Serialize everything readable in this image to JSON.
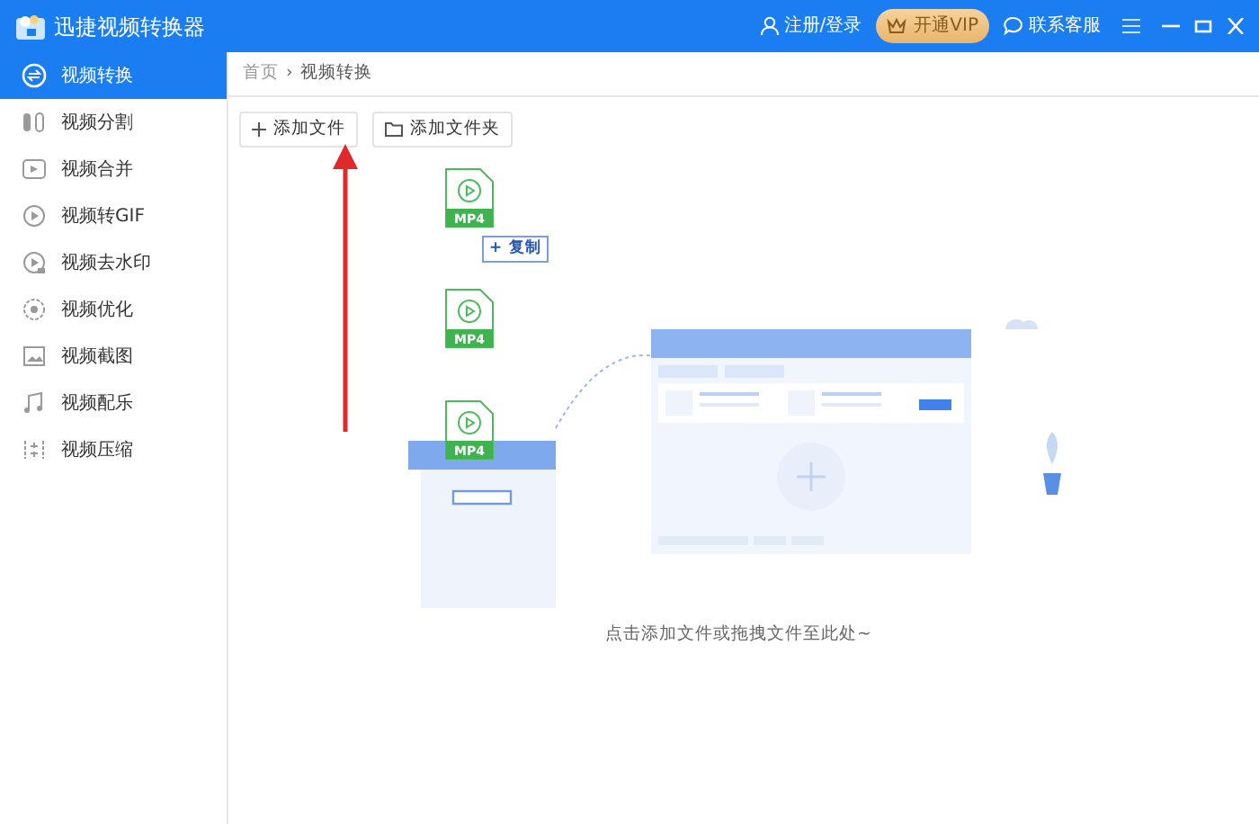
{
  "app": {
    "title": "迅捷视频转换器"
  },
  "header": {
    "login": "注册/登录",
    "vip": "开通VIP",
    "support": "联系客服"
  },
  "sidebar": {
    "items": [
      {
        "label": "视频转换",
        "selected": true,
        "kind": "convert"
      },
      {
        "label": "视频分割",
        "selected": false,
        "kind": "split"
      },
      {
        "label": "视频合并",
        "selected": false,
        "kind": "merge"
      },
      {
        "label": "视频转GIF",
        "selected": false,
        "kind": "gif"
      },
      {
        "label": "视频去水印",
        "selected": false,
        "kind": "watermark"
      },
      {
        "label": "视频优化",
        "selected": false,
        "kind": "optimize"
      },
      {
        "label": "视频截图",
        "selected": false,
        "kind": "screenshot"
      },
      {
        "label": "视频配乐",
        "selected": false,
        "kind": "music"
      },
      {
        "label": "视频压缩",
        "selected": false,
        "kind": "compress"
      }
    ]
  },
  "breadcrumb": {
    "items": [
      "首页",
      "视频转换"
    ],
    "separator": "›"
  },
  "toolbar": {
    "buttons": [
      {
        "label": "添加文件",
        "kind": "plus"
      },
      {
        "label": "添加文件夹",
        "kind": "folder"
      }
    ]
  },
  "dragged_files": [
    {
      "type": "MP4"
    },
    {
      "type": "MP4"
    },
    {
      "type": "MP4"
    }
  ],
  "drag_tooltip": {
    "symbol": "+",
    "label": "复制"
  },
  "drop_hint": "点击添加文件或拖拽文件至此处~"
}
